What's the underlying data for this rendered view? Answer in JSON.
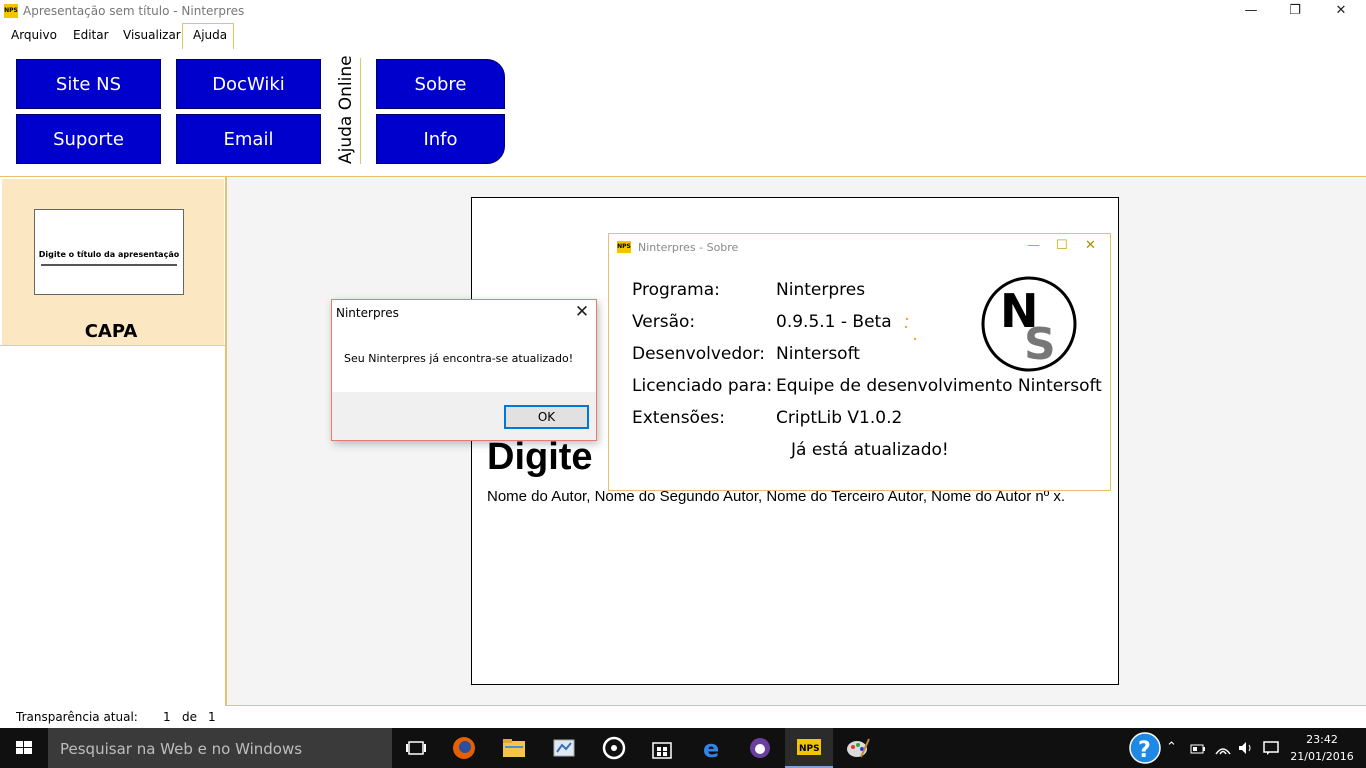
{
  "window": {
    "title": "Apresentação sem título - Ninterpres",
    "icon_text": "NPS",
    "minimize": "—",
    "restore": "❐",
    "close": "✕"
  },
  "menu": {
    "items": [
      "Arquivo",
      "Editar",
      "Visualizar",
      "Ajuda"
    ],
    "active": "Ajuda"
  },
  "ribbon": {
    "buttons": {
      "site_ns": "Site NS",
      "docwiki": "DocWiki",
      "suporte": "Suporte",
      "email": "Email",
      "sobre": "Sobre",
      "info": "Info"
    },
    "group_label": "Ajuda Online",
    "button_color": "#0000cc"
  },
  "slides_panel": {
    "thumb_title": "Digite o título da apresentação",
    "slide_label": "CAPA",
    "selected_bg": "#fbe8c2"
  },
  "slide": {
    "title": "Digite",
    "authors": "Nome do Autor, Nome do Segundo Autor, Nome do Terceiro Autor, Nome do Autor nº x."
  },
  "about": {
    "title": "Ninterpres - Sobre",
    "icon_text": "NPS",
    "rows": [
      {
        "label": "Programa:",
        "value": "Ninterpres"
      },
      {
        "label": "Versão:",
        "value": "0.9.5.1 - Beta"
      },
      {
        "label": "Desenvolvedor:",
        "value": "Nintersoft"
      },
      {
        "label": "Licenciado para:",
        "value": "Equipe de desenvolvimento Nintersoft"
      },
      {
        "label": "Extensões:",
        "value": "CriptLib V1.0.2"
      }
    ],
    "status": "Já está atualizado!",
    "logo_letters": {
      "top": "N",
      "bottom": "S"
    },
    "accent": "#e8c26a"
  },
  "message_box": {
    "title": "Ninterpres",
    "text": "Seu Ninterpres já encontra-se atualizado!",
    "ok": "OK",
    "close": "✕"
  },
  "status_bar": {
    "label": "Transparência atual:",
    "current": "1",
    "of": "de",
    "total": "1"
  },
  "taskbar": {
    "search_placeholder": "Pesquisar na Web e no Windows",
    "apps": [
      "task-view",
      "firefox",
      "file-explorer",
      "paint",
      "groove",
      "store",
      "edge",
      "app-purple",
      "ninterpres",
      "paint-brush"
    ],
    "active_app": "ninterpres",
    "time": "23:42",
    "date": "21/01/2016"
  }
}
